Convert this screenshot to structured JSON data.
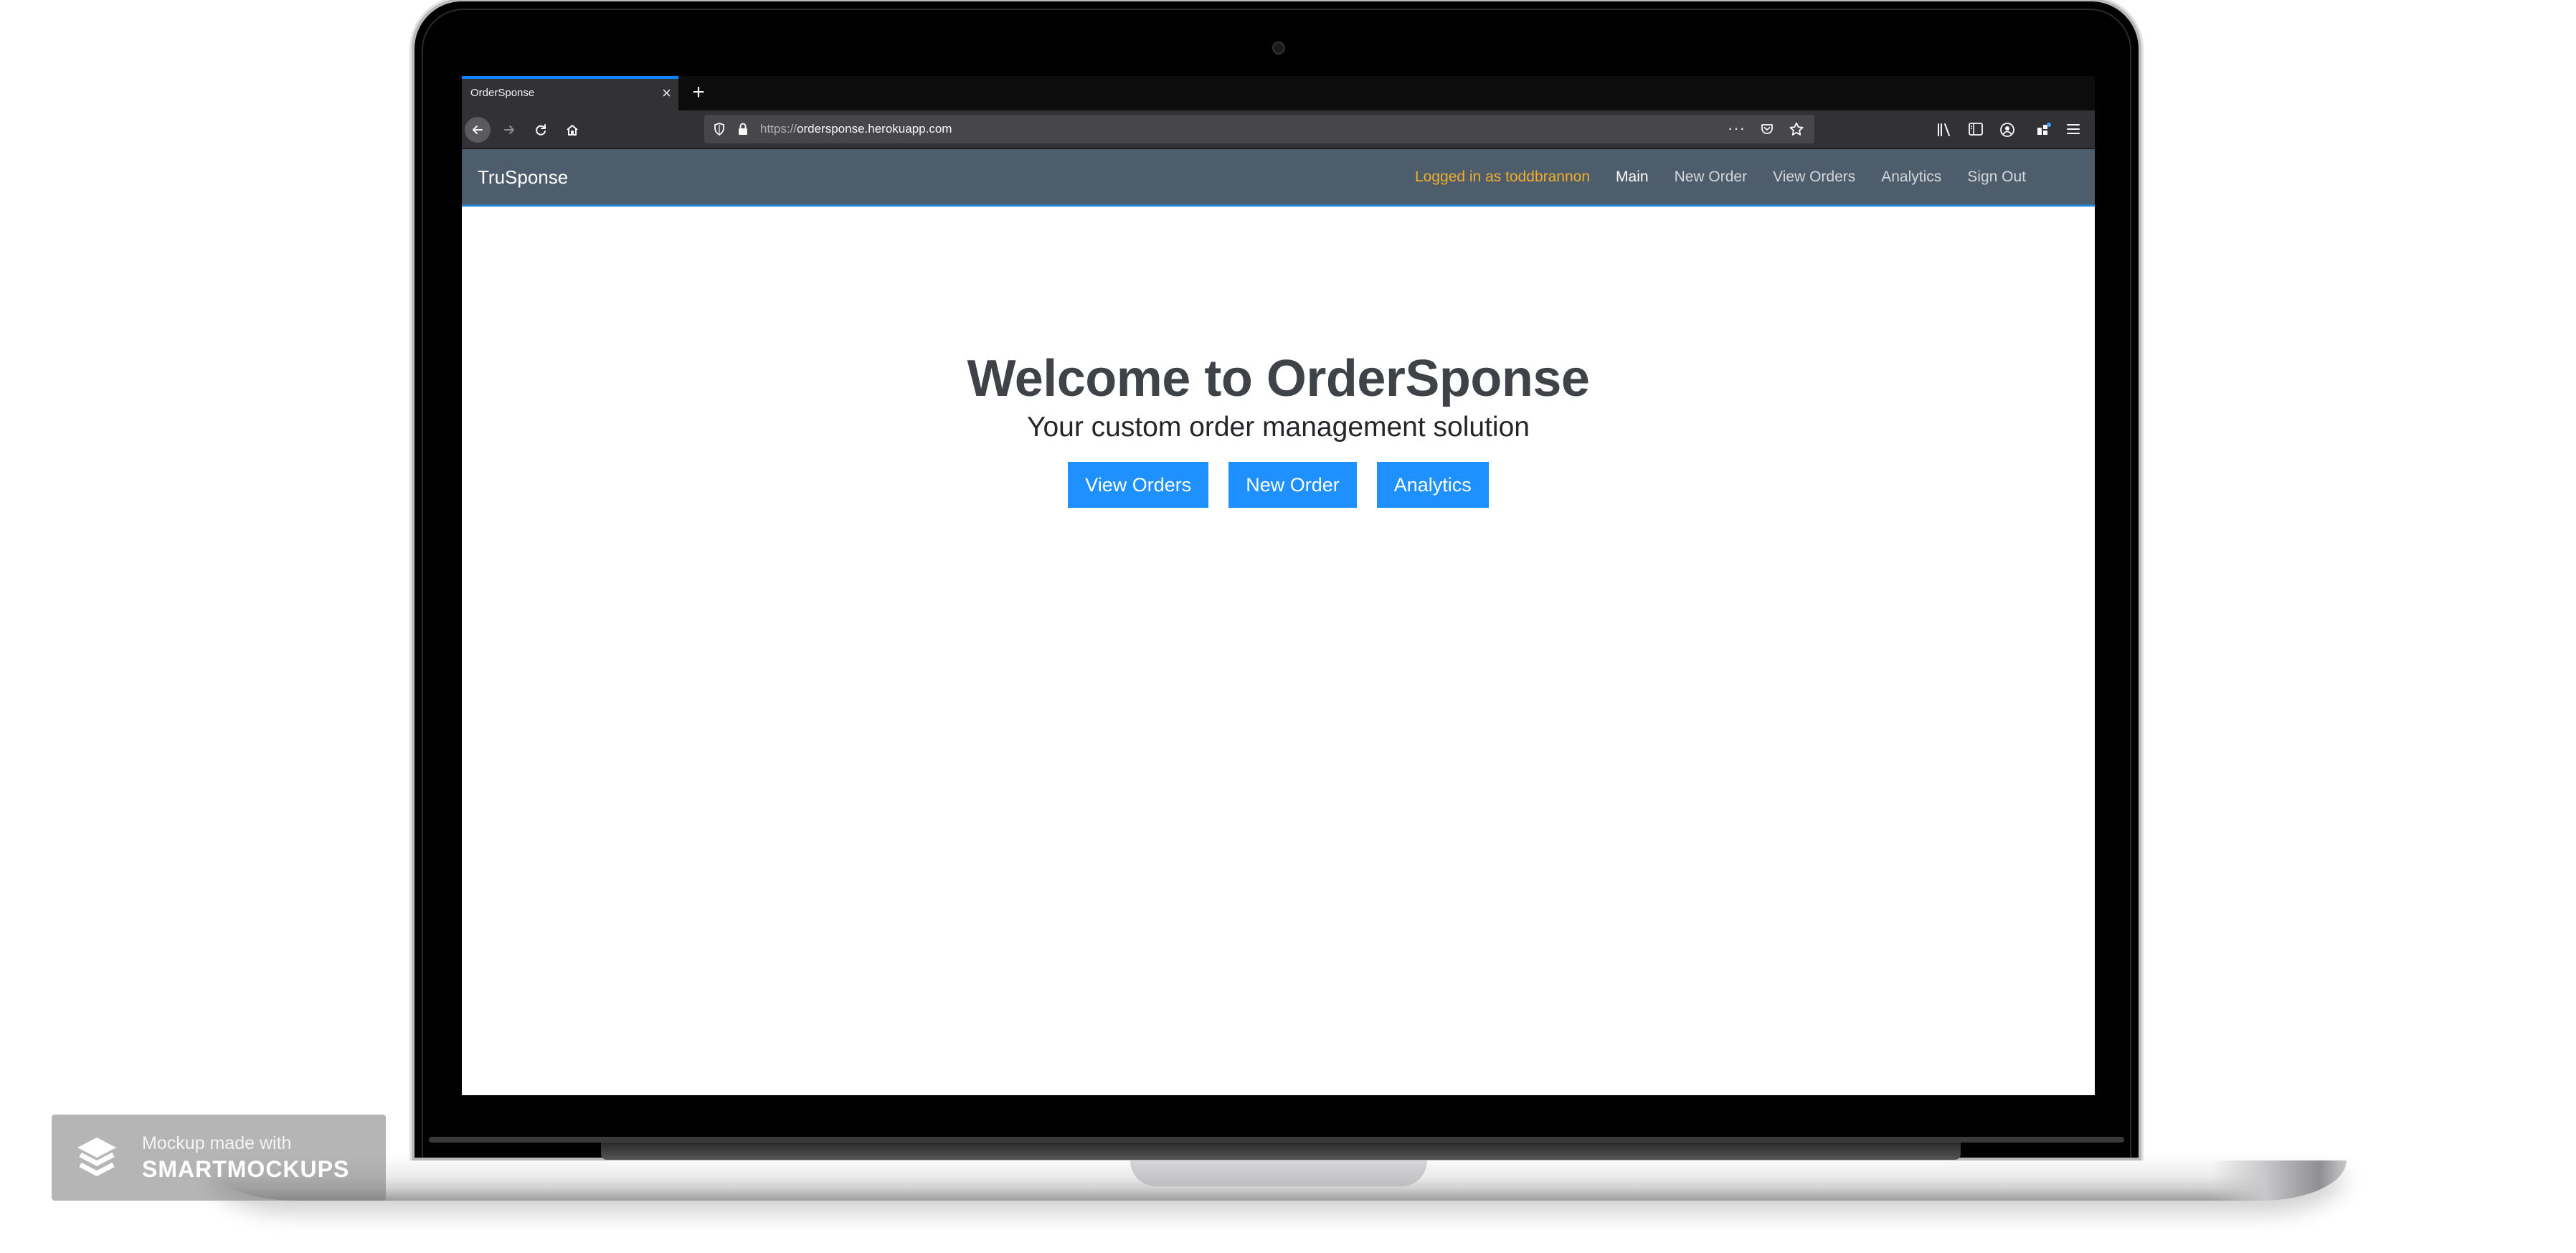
{
  "browser": {
    "tab_title": "OrderSponse",
    "tab_close": "×",
    "new_tab": "+",
    "url_scheme": "https://",
    "url_host": "ordersponse.herokuapp.com",
    "url_more": "···"
  },
  "navbar": {
    "brand": "TruSponse",
    "logged_in": "Logged in as toddbrannon",
    "links": [
      "Main",
      "New Order",
      "View Orders",
      "Analytics",
      "Sign Out"
    ],
    "active_link": "Main"
  },
  "hero": {
    "title": "Welcome to OrderSponse",
    "subtitle": "Your custom order management solution",
    "buttons": [
      "View Orders",
      "New Order",
      "Analytics"
    ]
  },
  "watermark": {
    "line1": "Mockup made with",
    "line2": "SMARTMOCKUPS"
  },
  "colors": {
    "navbar_bg": "#4e5d6c",
    "logged_in_text": "#f0ad2a",
    "button_bg": "#1e90ff",
    "tab_accent": "#0a84ff"
  }
}
